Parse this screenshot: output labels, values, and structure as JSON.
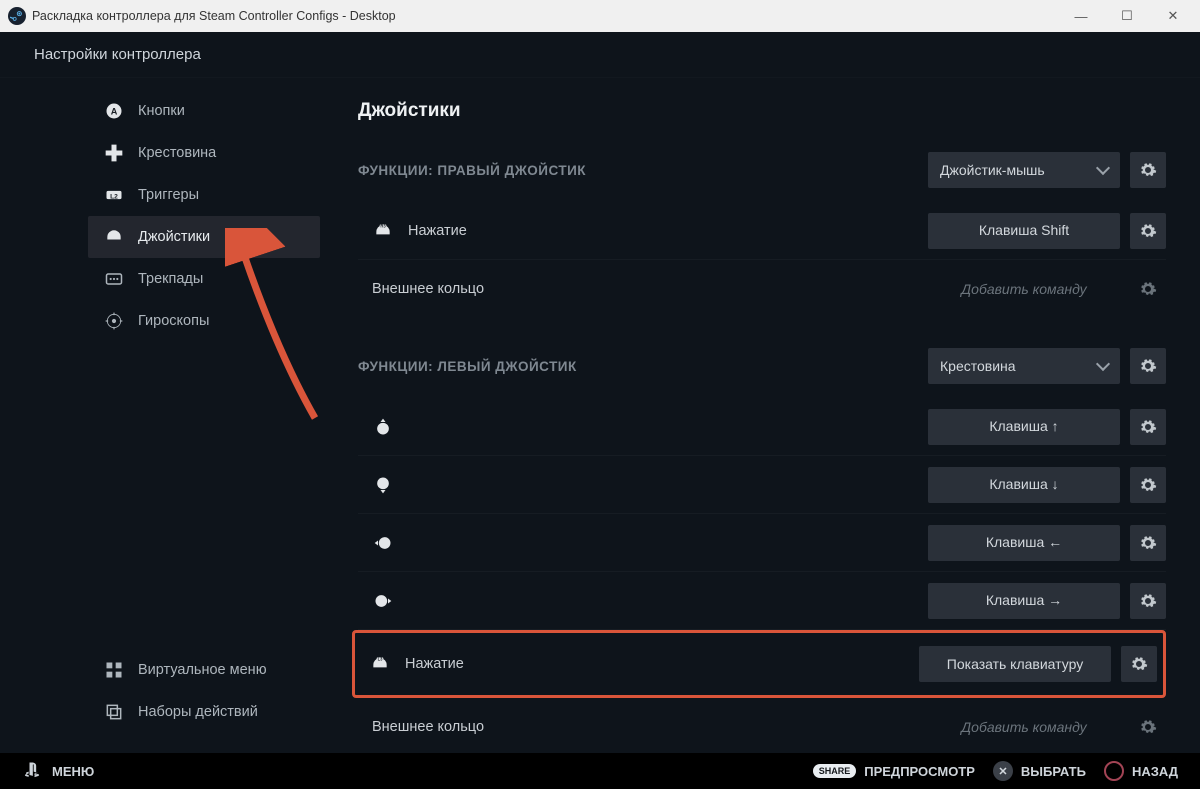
{
  "titlebar": {
    "title": "Раскладка контроллера для Steam Controller Configs - Desktop"
  },
  "header": {
    "title": "Настройки контроллера"
  },
  "sidebar": {
    "items": [
      {
        "label": "Кнопки"
      },
      {
        "label": "Крестовина"
      },
      {
        "label": "Триггеры"
      },
      {
        "label": "Джойстики"
      },
      {
        "label": "Трекпады"
      },
      {
        "label": "Гироскопы"
      }
    ],
    "bottom": [
      {
        "label": "Виртуальное меню"
      },
      {
        "label": "Наборы действий"
      }
    ]
  },
  "content": {
    "title": "Джойстики",
    "right_section": {
      "label": "ФУНКЦИИ: ПРАВЫЙ ДЖОЙСТИК",
      "dropdown": "Джойстик-мышь",
      "rows": [
        {
          "label": "Нажатие",
          "value": "Клавиша Shift",
          "has_icon": true
        },
        {
          "label": "Внешнее кольцо",
          "value": "Добавить команду",
          "ghost": true
        }
      ]
    },
    "left_section": {
      "label": "ФУНКЦИИ: ЛЕВЫЙ ДЖОЙСТИК",
      "dropdown": "Крестовина",
      "rows": [
        {
          "label": "",
          "value": "Клавиша ↑",
          "dir": "up"
        },
        {
          "label": "",
          "value": "Клавиша ↓",
          "dir": "down"
        },
        {
          "label": "",
          "value": "Клавиша ←",
          "dir": "left"
        },
        {
          "label": "",
          "value": "Клавиша →",
          "dir": "right"
        },
        {
          "label": "Нажатие",
          "value": "Показать клавиатуру",
          "has_icon": true,
          "highlight": true
        },
        {
          "label": "Внешнее кольцо",
          "value": "Добавить команду",
          "ghost": true
        }
      ]
    }
  },
  "bottombar": {
    "menu": "МЕНЮ",
    "preview_badge": "SHARE",
    "preview": "ПРЕДПРОСМОТР",
    "select": "ВЫБРАТЬ",
    "back": "НАЗАД"
  }
}
